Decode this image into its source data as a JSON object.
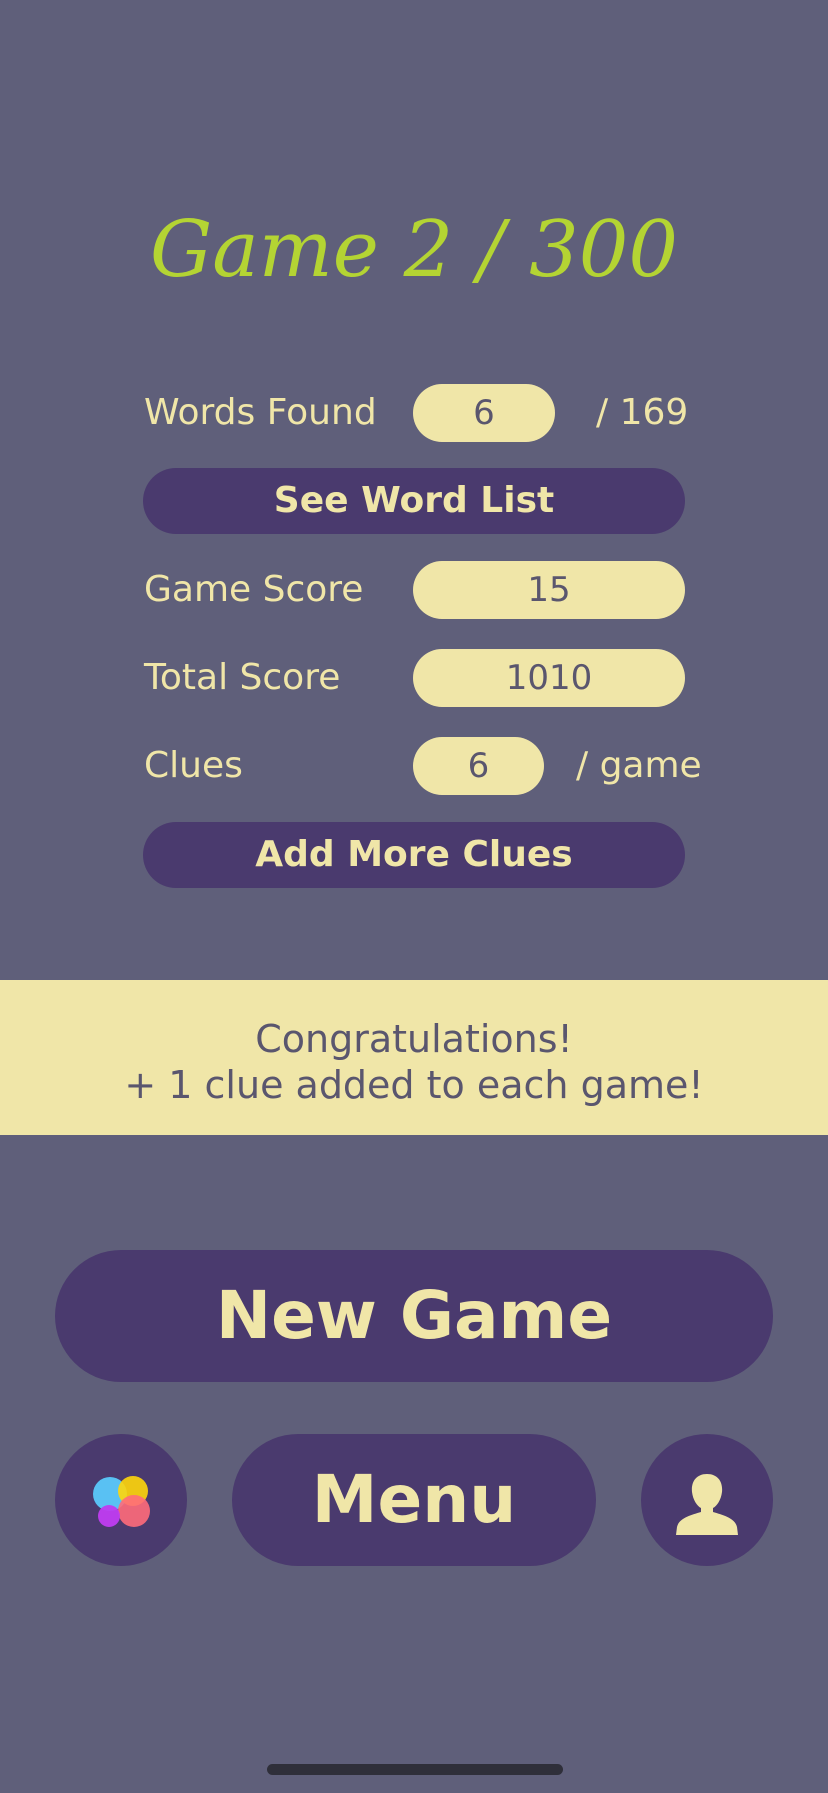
{
  "header": {
    "title": "Game 2 / 300"
  },
  "stats": {
    "words_found": {
      "label": "Words Found",
      "value": "6",
      "suffix": "/ 169"
    },
    "see_word_list_label": "See Word List",
    "game_score": {
      "label": "Game Score",
      "value": "15"
    },
    "total_score": {
      "label": "Total Score",
      "value": "1010"
    },
    "clues": {
      "label": "Clues",
      "value": "6",
      "suffix": "/ game"
    },
    "add_more_clues_label": "Add More Clues"
  },
  "banner": {
    "line1": "Congratulations!",
    "line2": "+ 1 clue added to each game!"
  },
  "actions": {
    "new_game_label": "New Game",
    "menu_label": "Menu",
    "game_center_icon": "game-center-icon",
    "profile_icon": "person-icon"
  },
  "colors": {
    "background": "#5f5f7a",
    "button": "#4a3a6e",
    "accent_cream": "#f0e6a8",
    "title_green": "#b4d433"
  }
}
